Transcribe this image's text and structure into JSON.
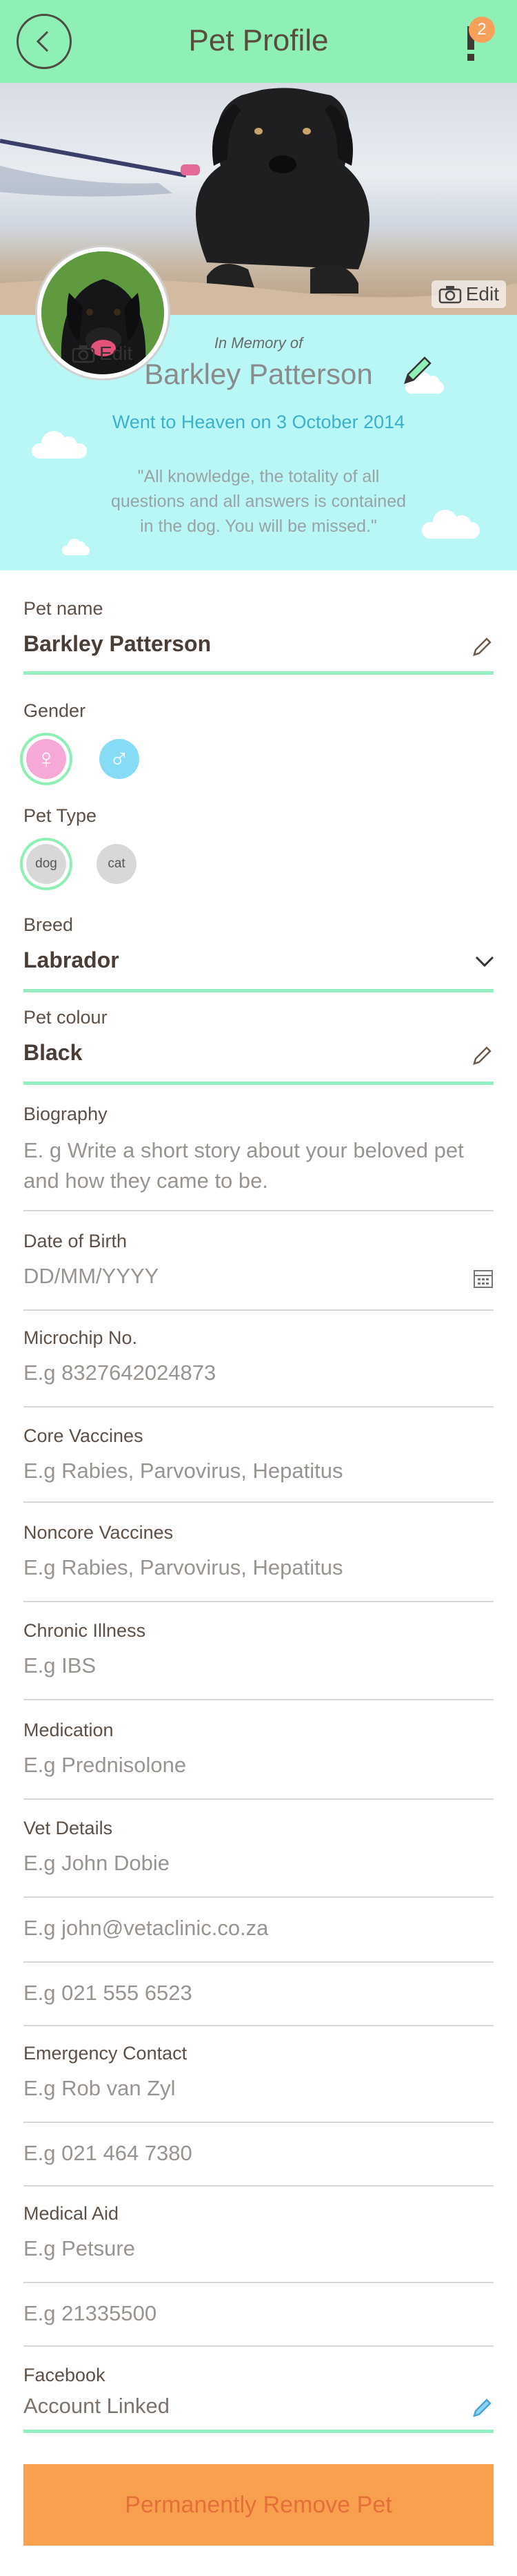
{
  "header": {
    "title": "Pet Profile",
    "notification_count": "2"
  },
  "cover": {
    "edit_label": "Edit"
  },
  "avatar": {
    "edit_label": "Edit"
  },
  "memorial": {
    "in_memory_label": "In Memory of",
    "pet_name": "Barkley Patterson",
    "heaven_text": "Went to Heaven on 3 October 2014",
    "quote_line1": "\"All knowledge, the totality of all",
    "quote_line2": "questions and all answers is contained",
    "quote_line3": "in the dog. You will be missed.\""
  },
  "form": {
    "pet_name": {
      "label": "Pet name",
      "value": "Barkley Patterson"
    },
    "gender": {
      "label": "Gender",
      "selected": "female"
    },
    "pet_type": {
      "label": "Pet Type",
      "options": [
        "dog",
        "cat"
      ],
      "selected": "dog"
    },
    "breed": {
      "label": "Breed",
      "value": "Labrador"
    },
    "pet_colour": {
      "label": "Pet colour",
      "value": "Black"
    },
    "biography": {
      "label": "Biography",
      "placeholder_line1": "E. g Write a short story about your beloved pet",
      "placeholder_line2": "and how they came to be."
    },
    "dob": {
      "label": "Date of Birth",
      "placeholder": "DD/MM/YYYY"
    },
    "microchip": {
      "label": "Microchip No.",
      "placeholder": "E.g 8327642024873"
    },
    "core_vaccines": {
      "label": "Core Vaccines",
      "placeholder": "E.g Rabies, Parvovirus, Hepatitus"
    },
    "noncore_vaccines": {
      "label": "Noncore Vaccines",
      "placeholder": "E.g Rabies, Parvovirus, Hepatitus"
    },
    "chronic_illness": {
      "label": "Chronic Illness",
      "placeholder": "E.g IBS"
    },
    "medication": {
      "label": "Medication",
      "placeholder": "E.g Prednisolone"
    },
    "vet_details": {
      "label": "Vet Details",
      "name_placeholder": "E.g John Dobie",
      "email_placeholder": "E.g john@vetaclinic.co.za",
      "phone_placeholder": "E.g 021 555 6523"
    },
    "emergency_contact": {
      "label": "Emergency Contact",
      "name_placeholder": "E.g Rob van Zyl",
      "phone_placeholder": "E.g 021 464 7380"
    },
    "medical_aid": {
      "label": "Medical Aid",
      "name_placeholder": "E.g Petsure",
      "number_placeholder": "E.g 21335500"
    },
    "facebook": {
      "label": "Facebook",
      "value": "Account Linked"
    }
  },
  "remove_button": "Permanently Remove Pet",
  "colors": {
    "header_bg": "#8ef0b4",
    "memorial_bg": "#b9f6f6",
    "accent_green": "#95eec0",
    "remove_bg": "#f9a04e",
    "heaven_text": "#3bb0c9"
  }
}
